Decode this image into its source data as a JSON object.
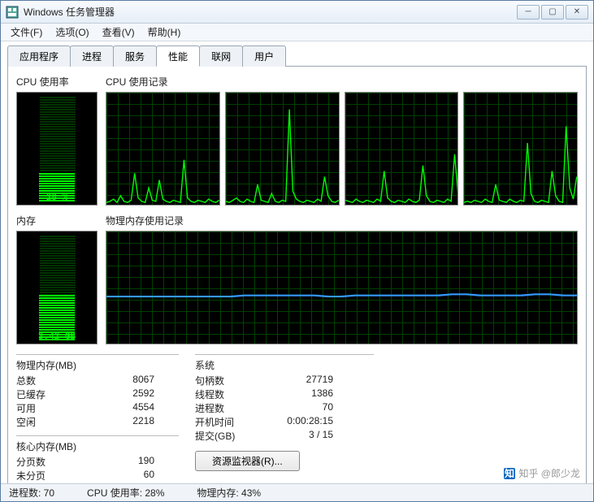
{
  "window": {
    "title": "Windows 任务管理器"
  },
  "menu": {
    "file": "文件(F)",
    "options": "选项(O)",
    "view": "查看(V)",
    "help": "帮助(H)"
  },
  "tabs": {
    "apps": "应用程序",
    "processes": "进程",
    "services": "服务",
    "performance": "性能",
    "networking": "联网",
    "users": "用户"
  },
  "labels": {
    "cpu_usage": "CPU 使用率",
    "cpu_history": "CPU 使用记录",
    "memory": "内存",
    "phys_mem_history": "物理内存使用记录"
  },
  "gauges": {
    "cpu_pct": "28 %",
    "mem_gb": "3.42 GB"
  },
  "physmem": {
    "header": "物理内存(MB)",
    "total_lbl": "总数",
    "total_val": "8067",
    "cached_lbl": "已缓存",
    "cached_val": "2592",
    "avail_lbl": "可用",
    "avail_val": "4554",
    "free_lbl": "空闲",
    "free_val": "2218"
  },
  "kernel": {
    "header": "核心内存(MB)",
    "paged_lbl": "分页数",
    "paged_val": "190",
    "nonpaged_lbl": "未分页",
    "nonpaged_val": "60"
  },
  "system": {
    "header": "系统",
    "handles_lbl": "句柄数",
    "handles_val": "27719",
    "threads_lbl": "线程数",
    "threads_val": "1386",
    "procs_lbl": "进程数",
    "procs_val": "70",
    "uptime_lbl": "开机时间",
    "uptime_val": "0:00:28:15",
    "commit_lbl": "提交(GB)",
    "commit_val": "3 / 15"
  },
  "res_monitor": "资源监视器(R)...",
  "status": {
    "procs": "进程数: 70",
    "cpu": "CPU 使用率: 28%",
    "mem": "物理内存: 43%"
  },
  "watermark": "知乎 @郎少龙",
  "chart_data": {
    "cpu_gauge_pct": 28,
    "mem_gauge_pct": 43,
    "cpu_history": {
      "type": "line",
      "cores": 4,
      "ylim": [
        0,
        100
      ],
      "series": [
        {
          "name": "core0",
          "values": [
            2,
            3,
            5,
            2,
            8,
            3,
            2,
            4,
            28,
            6,
            3,
            2,
            15,
            4,
            3,
            22,
            5,
            3,
            2,
            4,
            3,
            2,
            40,
            6,
            3,
            2,
            4,
            3,
            2,
            5,
            3,
            2,
            4
          ]
        },
        {
          "name": "core1",
          "values": [
            3,
            2,
            4,
            6,
            3,
            2,
            5,
            3,
            2,
            18,
            4,
            3,
            2,
            10,
            3,
            2,
            4,
            3,
            85,
            12,
            5,
            3,
            2,
            4,
            3,
            2,
            5,
            3,
            25,
            8,
            3,
            2,
            4
          ]
        },
        {
          "name": "core2",
          "values": [
            4,
            3,
            2,
            5,
            3,
            2,
            4,
            3,
            2,
            5,
            3,
            30,
            6,
            3,
            2,
            4,
            3,
            2,
            5,
            3,
            2,
            4,
            35,
            8,
            3,
            2,
            4,
            3,
            2,
            5,
            3,
            45,
            10
          ]
        },
        {
          "name": "core3",
          "values": [
            2,
            3,
            2,
            4,
            3,
            2,
            5,
            3,
            2,
            18,
            4,
            3,
            2,
            5,
            3,
            2,
            4,
            3,
            55,
            10,
            3,
            2,
            4,
            3,
            2,
            30,
            8,
            3,
            2,
            70,
            15,
            5,
            25
          ]
        }
      ]
    },
    "memory_history": {
      "type": "line",
      "ylim": [
        0,
        100
      ],
      "values": [
        42,
        42,
        42,
        42,
        42,
        42,
        42,
        42,
        42,
        42,
        43,
        43,
        43,
        43,
        43,
        43,
        42,
        42,
        43,
        43,
        43,
        43,
        43,
        43,
        43,
        44,
        44,
        43,
        43,
        43,
        43,
        44,
        44,
        43,
        43
      ]
    }
  }
}
